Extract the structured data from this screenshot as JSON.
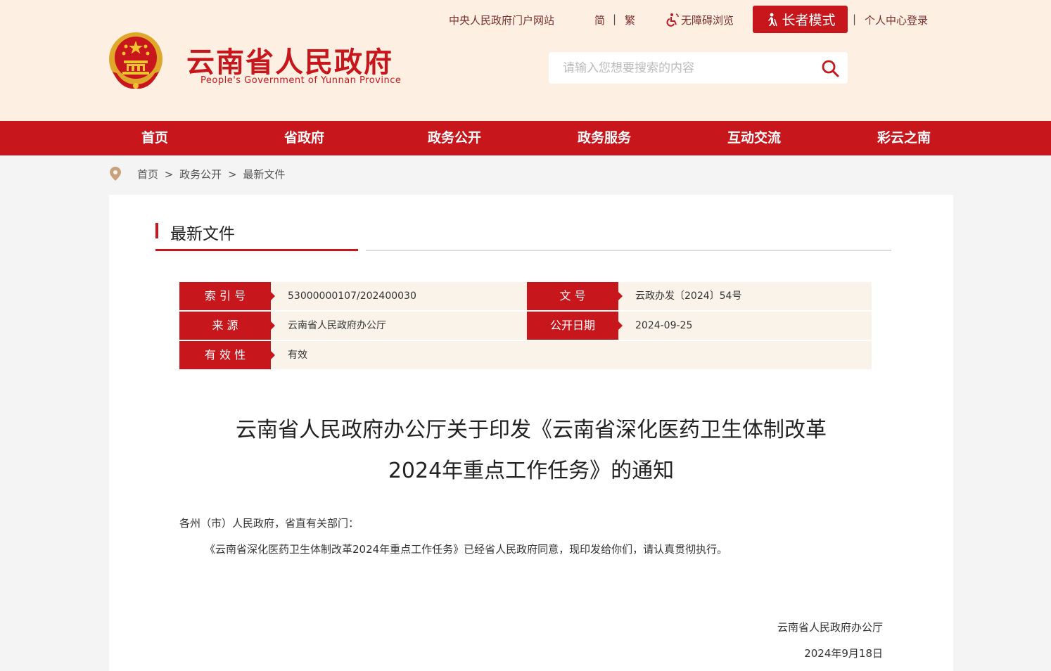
{
  "header": {
    "site_title": "云南省人民政府",
    "site_subtitle": "People's Government of Yunnan Province",
    "links": {
      "portal": "中央人民政府门户网站",
      "simplified": "简",
      "traditional": "繁",
      "accessibility": "无障碍浏览",
      "elder_mode": "长者模式",
      "login": "个人中心登录"
    },
    "search": {
      "placeholder": "请输入您想要搜索的内容"
    }
  },
  "nav": {
    "items": [
      "首页",
      "省政府",
      "政务公开",
      "政务服务",
      "互动交流",
      "彩云之南"
    ]
  },
  "breadcrumb": [
    "首页",
    "政务公开",
    "最新文件"
  ],
  "breadcrumb_sep": ">",
  "section_title": "最新文件",
  "meta": {
    "index_label": "索 引 号",
    "index_value": "53000000107/202400030",
    "docno_label": "文        号",
    "docno_value": "云政办发〔2024〕54号",
    "source_label": "来      源",
    "source_value": "云南省人民政府办公厅",
    "date_label": "公开日期",
    "date_value": "2024-09-25",
    "validity_label": "有 效 性",
    "validity_value": "有效"
  },
  "document": {
    "title_line1": "云南省人民政府办公厅关于印发《云南省深化医药卫生体制改革",
    "title_line2": "2024年重点工作任务》的通知",
    "salutation": "各州（市）人民政府，省直有关部门：",
    "paragraph1": "《云南省深化医药卫生体制改革2024年重点工作任务》已经省人民政府同意，现印发给你们，请认真贯彻执行。",
    "signature_org": "云南省人民政府办公厅",
    "signature_date": "2024年9月18日"
  },
  "colors": {
    "brand_red": "#c8161d",
    "header_bg": "#fdf0e2"
  }
}
